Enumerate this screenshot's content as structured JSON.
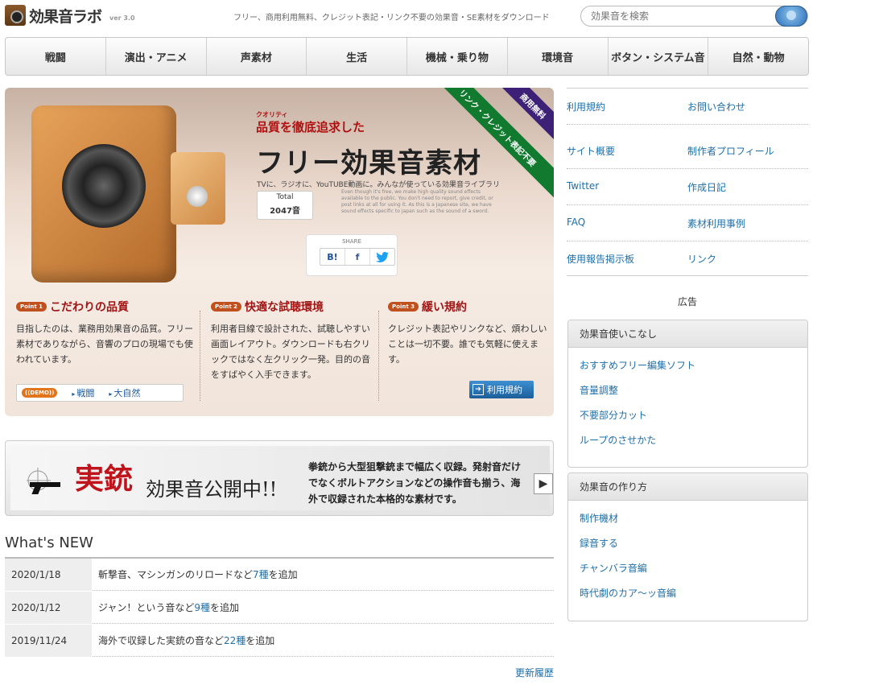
{
  "header": {
    "logo_text": "効果音ラボ",
    "version": "ver 3.0",
    "tagline": "フリー、商用利用無料、クレジット表記・リンク不要の効果音・SE素材をダウンロード",
    "search_placeholder": "効果音を検索"
  },
  "nav": [
    "戦闘",
    "演出・アニメ",
    "声素材",
    "生活",
    "機械・乗り物",
    "環境音",
    "ボタン・システム音",
    "自然・動物"
  ],
  "hero": {
    "subtitle": "品質を徹底追求した",
    "subtitle_ruby": "クオリティ",
    "title": "フリー効果音素材",
    "desc": "TVに、ラジオに、YouTUBE動画に。みんなが使っている効果音ライブラリ",
    "total_label": "Total",
    "total_count": "2047音",
    "english_note": "Even though it's free, we make high quality sound effects available to the public. You don't need to report, give credit, or post links at all for using it. As this is a Japanese site, we have sound effects specific to Japan such as the sound of a sword.",
    "share_label": "SHARE",
    "share_buttons": [
      "B!",
      "f",
      "t"
    ],
    "ribbon_top": "商用無料",
    "ribbon_bottom": "リンク・クレジット表記不要",
    "points": [
      {
        "num": "Point 1",
        "title": "こだわりの品質",
        "text": "目指したのは、業務用効果音の品質。フリー素材でありながら、音響のプロの現場でも使われています。"
      },
      {
        "num": "Point 2",
        "title": "快適な試聴環境",
        "text": "利用者目線で設計された、試聴しやすい画面レイアウト。ダウンロードも右クリックではなく左クリック一発。目的の音をすばやく入手できます。"
      },
      {
        "num": "Point 3",
        "title": "緩い規約",
        "text": "クレジット表記やリンクなど、煩わしいことは一切不要。誰でも気軽に使えます。"
      }
    ],
    "demo_tag": "((DEMO))",
    "demo_links": [
      "戦闘",
      "大自然"
    ],
    "terms_button": "利用規約"
  },
  "banner": {
    "title_red": "実銃",
    "title_black": "効果音公開中!!",
    "desc": "拳銃から大型狙撃銃まで幅広く収録。発射音だけでなくボルトアクションなどの操作音も揃う、海外で収録された本格的な素材です。"
  },
  "news": {
    "heading": "What's NEW",
    "items": [
      {
        "date": "2020/1/18",
        "before": "斬撃音、マシンガンのリロードなど",
        "count": "7種",
        "after": "を追加"
      },
      {
        "date": "2020/1/12",
        "before": "ジャン！という音など",
        "count": "9種",
        "after": "を追加"
      },
      {
        "date": "2019/11/24",
        "before": "海外で収録した実銃の音など",
        "count": "22種",
        "after": "を追加"
      }
    ],
    "more": "更新履歴"
  },
  "sidebar": {
    "links": [
      [
        "利用規約",
        "お問い合わせ"
      ],
      [
        "サイト概要",
        "制作者プロフィール"
      ],
      [
        "Twitter",
        "作成日記"
      ],
      [
        "FAQ",
        "素材利用事例"
      ],
      [
        "使用報告掲示板",
        "リンク"
      ]
    ],
    "ad_label": "広告",
    "box1": {
      "title": "効果音使いこなし",
      "items": [
        "おすすめフリー編集ソフト",
        "音量調整",
        "不要部分カット",
        "ループのさせかた"
      ]
    },
    "box2": {
      "title": "効果音の作り方",
      "items": [
        "制作機材",
        "録音する",
        "チャンバラ音編",
        "時代劇のカア〜ッ音編"
      ]
    }
  }
}
